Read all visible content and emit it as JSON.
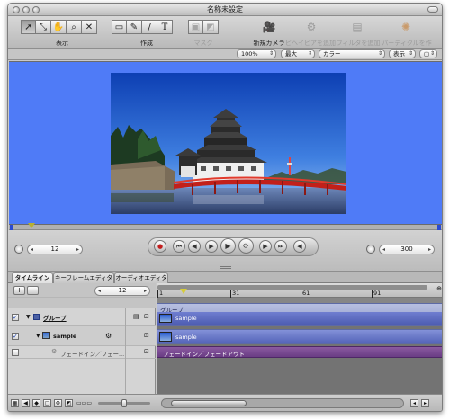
{
  "window": {
    "title": "名称未設定"
  },
  "toolbar": {
    "groups": [
      {
        "label": "表示"
      },
      {
        "label": "作成"
      },
      {
        "label": "マスク"
      }
    ],
    "actions": [
      {
        "label": "新規カメラ"
      },
      {
        "label": "ビヘイビアを追加"
      },
      {
        "label": "フィルタを追加"
      },
      {
        "label": "パーティクルを作成"
      }
    ]
  },
  "options_bar": {
    "zoom": "100%",
    "quality": "最大",
    "channels": "カラー",
    "view": "表示"
  },
  "canvas": {
    "background_color": "#4f7bf7"
  },
  "transport": {
    "current_frame": "12",
    "end_frame": "300"
  },
  "tabs": [
    {
      "label": "タイムライン"
    },
    {
      "label": "キーフレームエディタ"
    },
    {
      "label": "オーディオエディタ"
    }
  ],
  "timeline": {
    "frame_field": "12",
    "ruler_marks": [
      "1",
      "31",
      "61",
      "91"
    ],
    "layers": [
      {
        "name": "グループ"
      },
      {
        "name": "sample"
      },
      {
        "name": "フェードイン／フェー..."
      }
    ],
    "track_header": "グループ",
    "clips": [
      {
        "label": "sample"
      },
      {
        "label": "sample"
      },
      {
        "label": "フェードイン／フェードアウト"
      }
    ]
  }
}
